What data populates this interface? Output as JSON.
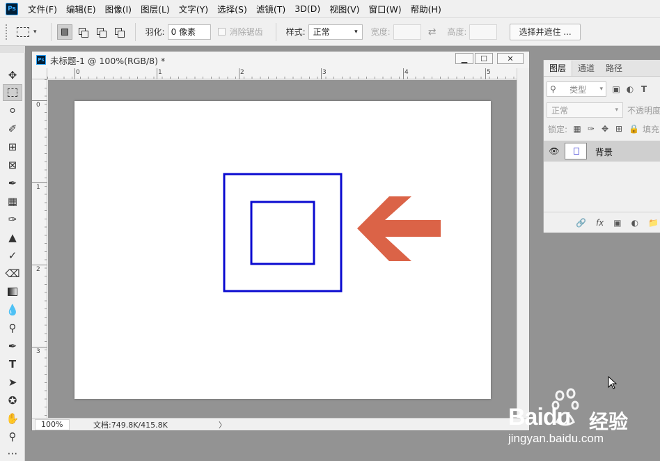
{
  "app": {
    "logo_text": "Ps",
    "menu": [
      "文件(F)",
      "编辑(E)",
      "图像(I)",
      "图层(L)",
      "文字(Y)",
      "选择(S)",
      "滤镜(T)",
      "3D(D)",
      "视图(V)",
      "窗口(W)",
      "帮助(H)"
    ]
  },
  "options": {
    "feather_label": "羽化:",
    "feather_value": "0 像素",
    "antialias_label": "消除锯齿",
    "style_label": "样式:",
    "style_value": "正常",
    "width_label": "宽度:",
    "height_label": "高度:",
    "select_mask_button": "选择并遮住 ..."
  },
  "document": {
    "title": "未标题-1 @ 100%(RGB/8) *",
    "minimize": "▁",
    "maximize": "☐",
    "close": "✕",
    "ruler_h_labels": [
      "0",
      "1",
      "2",
      "3",
      "4",
      "5"
    ],
    "ruler_v_labels": [
      "0",
      "1",
      "2",
      "3"
    ],
    "zoom": "100%",
    "doc_info": "文档:749.8K/415.8K",
    "status_chevron": "〉"
  },
  "canvas": {
    "outer_square_color": "#0a0ad0",
    "inner_square_color": "#0a0ad0",
    "arrow_color": "#db6347"
  },
  "layers": {
    "tabs": [
      "图层",
      "通道",
      "路径"
    ],
    "kind_label": "类型",
    "blend_mode": "正常",
    "opacity_label": "不透明度",
    "lock_label": "锁定:",
    "fill_label": "填充",
    "layer_name": "背景"
  },
  "watermark": {
    "brand": "Baidu",
    "brand_cn": "经验",
    "url": "jingyan.baidu.com"
  }
}
